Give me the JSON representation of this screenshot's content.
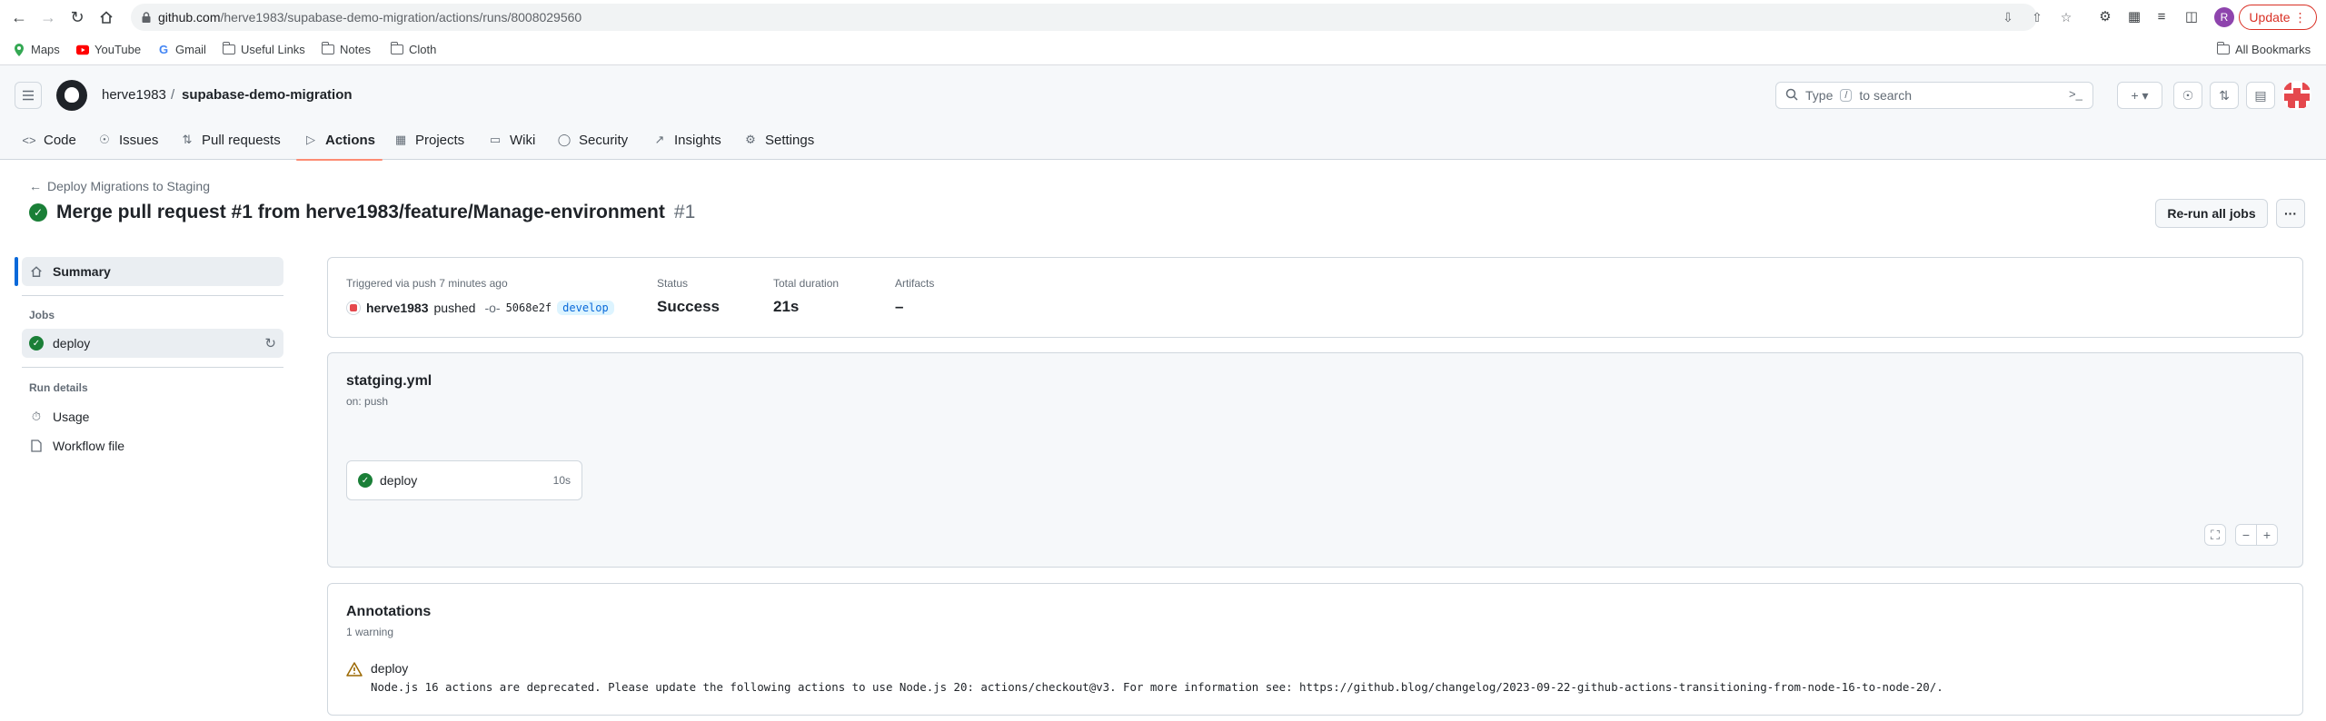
{
  "browser": {
    "url_host": "github.com",
    "url_path": "/herve1983/supabase-demo-migration/actions/runs/8008029560",
    "profile_initial": "R",
    "update_label": "Update",
    "bookmarks": [
      "Maps",
      "YouTube",
      "Gmail",
      "Useful Links",
      "Notes",
      "Cloth"
    ],
    "all_bookmarks": "All Bookmarks"
  },
  "header": {
    "owner": "herve1983",
    "separator": "/",
    "repo": "supabase-demo-migration",
    "search_placeholder_pre": "Type",
    "search_key": "/",
    "search_placeholder_post": "to search"
  },
  "repo_nav": {
    "tabs": [
      {
        "label": "Code",
        "icon": "code-icon"
      },
      {
        "label": "Issues",
        "icon": "issue-icon"
      },
      {
        "label": "Pull requests",
        "icon": "pull-request-icon"
      },
      {
        "label": "Actions",
        "icon": "play-icon",
        "active": true
      },
      {
        "label": "Projects",
        "icon": "table-icon"
      },
      {
        "label": "Wiki",
        "icon": "book-icon"
      },
      {
        "label": "Security",
        "icon": "shield-icon"
      },
      {
        "label": "Insights",
        "icon": "graph-icon"
      },
      {
        "label": "Settings",
        "icon": "gear-icon"
      }
    ]
  },
  "run": {
    "back_label": "Deploy Migrations to Staging",
    "title": "Merge pull request #1 from herve1983/feature/Manage-environment",
    "number": "#1",
    "rerun_label": "Re-run all jobs",
    "more_label": "···"
  },
  "sidebar": {
    "summary": "Summary",
    "jobs_heading": "Jobs",
    "job_name": "deploy",
    "run_details_heading": "Run details",
    "usage": "Usage",
    "workflow_file": "Workflow file"
  },
  "summary": {
    "triggered": "Triggered via push 7 minutes ago",
    "actor": "herve1983",
    "action": "pushed",
    "commit": "5068e2f",
    "branch": "develop",
    "status_label": "Status",
    "status_value": "Success",
    "duration_label": "Total duration",
    "duration_value": "21s",
    "artifacts_label": "Artifacts",
    "artifacts_value": "–"
  },
  "workflow": {
    "file": "statging.yml",
    "trigger": "on: push",
    "job_name": "deploy",
    "job_duration": "10s"
  },
  "annotations": {
    "title": "Annotations",
    "count": "1 warning",
    "job": "deploy",
    "message": "Node.js 16 actions are deprecated. Please update the following actions to use Node.js 20: actions/checkout@v3. For more information see: https://github.blog/changelog/2023-09-22-github-actions-transitioning-from-node-16-to-node-20/."
  },
  "colors": {
    "success": "#1a7f37",
    "accent": "#0969da",
    "active_tab_underline": "#fd8c73",
    "warning": "#9a6700"
  }
}
